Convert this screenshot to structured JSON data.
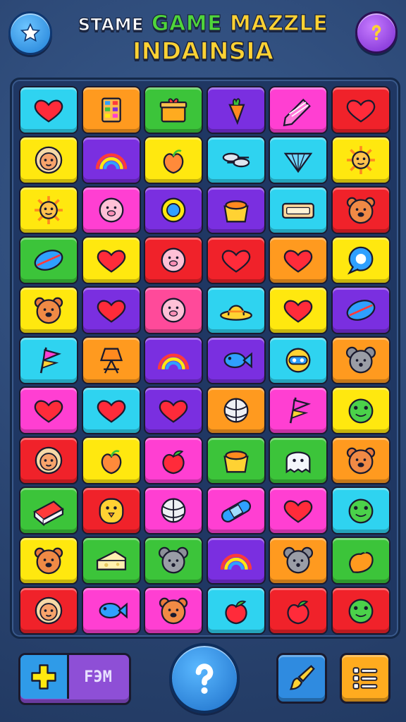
{
  "header": {
    "title_word1": "STAME",
    "title_word2": "GAME",
    "title_word3": "MAZZLE",
    "title_line2": "INDAINSIA",
    "star_button": "star-icon",
    "help_button": "question-icon"
  },
  "colors": {
    "cyan": "#2fd3f0",
    "orange": "#ff9a1f",
    "green": "#3cc43a",
    "purple": "#7a2fe0",
    "magenta": "#ff3fd2",
    "red": "#f0222a",
    "yellow": "#ffe80f",
    "pink": "#ff4a9a"
  },
  "board": {
    "rows": [
      [
        {
          "color": "cyan",
          "icon": "heart"
        },
        {
          "color": "orange",
          "icon": "tiles"
        },
        {
          "color": "green",
          "icon": "gift-box"
        },
        {
          "color": "purple",
          "icon": "carrot"
        },
        {
          "color": "magenta",
          "icon": "crayon"
        },
        {
          "color": "red",
          "icon": "heart"
        }
      ],
      [
        {
          "color": "yellow",
          "icon": "lion"
        },
        {
          "color": "purple",
          "icon": "rainbow"
        },
        {
          "color": "yellow",
          "icon": "peach"
        },
        {
          "color": "cyan",
          "icon": "spoons"
        },
        {
          "color": "cyan",
          "icon": "fan"
        },
        {
          "color": "yellow",
          "icon": "sun-face"
        }
      ],
      [
        {
          "color": "yellow",
          "icon": "sun-face"
        },
        {
          "color": "magenta",
          "icon": "pig-face"
        },
        {
          "color": "purple",
          "icon": "sun"
        },
        {
          "color": "purple",
          "icon": "pot"
        },
        {
          "color": "cyan",
          "icon": "box"
        },
        {
          "color": "red",
          "icon": "bear"
        }
      ],
      [
        {
          "color": "green",
          "icon": "leaf"
        },
        {
          "color": "yellow",
          "icon": "heart"
        },
        {
          "color": "red",
          "icon": "pig-face"
        },
        {
          "color": "red",
          "icon": "heart"
        },
        {
          "color": "orange",
          "icon": "heart"
        },
        {
          "color": "yellow",
          "icon": "speech-bubble"
        }
      ],
      [
        {
          "color": "yellow",
          "icon": "bear"
        },
        {
          "color": "purple",
          "icon": "heart"
        },
        {
          "color": "pink",
          "icon": "pig-face"
        },
        {
          "color": "cyan",
          "icon": "hat"
        },
        {
          "color": "yellow",
          "icon": "heart"
        },
        {
          "color": "purple",
          "icon": "leaf"
        }
      ],
      [
        {
          "color": "cyan",
          "icon": "flag"
        },
        {
          "color": "orange",
          "icon": "lamp"
        },
        {
          "color": "purple",
          "icon": "rainbow"
        },
        {
          "color": "purple",
          "icon": "fish"
        },
        {
          "color": "cyan",
          "icon": "robot"
        },
        {
          "color": "orange",
          "icon": "mouse"
        }
      ],
      [
        {
          "color": "magenta",
          "icon": "heart"
        },
        {
          "color": "cyan",
          "icon": "heart"
        },
        {
          "color": "purple",
          "icon": "heart"
        },
        {
          "color": "orange",
          "icon": "ball"
        },
        {
          "color": "magenta",
          "icon": "flag"
        },
        {
          "color": "yellow",
          "icon": "frog"
        }
      ],
      [
        {
          "color": "red",
          "icon": "lion"
        },
        {
          "color": "yellow",
          "icon": "peach"
        },
        {
          "color": "magenta",
          "icon": "apple"
        },
        {
          "color": "green",
          "icon": "pot"
        },
        {
          "color": "green",
          "icon": "ghost"
        },
        {
          "color": "orange",
          "icon": "bear"
        }
      ],
      [
        {
          "color": "green",
          "icon": "eraser"
        },
        {
          "color": "red",
          "icon": "chick"
        },
        {
          "color": "magenta",
          "icon": "ball"
        },
        {
          "color": "magenta",
          "icon": "bandage"
        },
        {
          "color": "magenta",
          "icon": "heart"
        },
        {
          "color": "cyan",
          "icon": "frog"
        }
      ],
      [
        {
          "color": "yellow",
          "icon": "bear"
        },
        {
          "color": "green",
          "icon": "cheese"
        },
        {
          "color": "green",
          "icon": "mouse"
        },
        {
          "color": "purple",
          "icon": "rainbow"
        },
        {
          "color": "orange",
          "icon": "mouse"
        },
        {
          "color": "green",
          "icon": "pepper"
        }
      ],
      [
        {
          "color": "red",
          "icon": "lion"
        },
        {
          "color": "magenta",
          "icon": "fish"
        },
        {
          "color": "magenta",
          "icon": "bear"
        },
        {
          "color": "cyan",
          "icon": "apple"
        },
        {
          "color": "red",
          "icon": "apple"
        },
        {
          "color": "red",
          "icon": "frog"
        }
      ]
    ]
  },
  "bottom_bar": {
    "power_label": "FЭM",
    "power_icon": "plus-icon",
    "hint_button": "question-icon",
    "brush_button": "brush-icon",
    "list_button": "list-icon"
  }
}
